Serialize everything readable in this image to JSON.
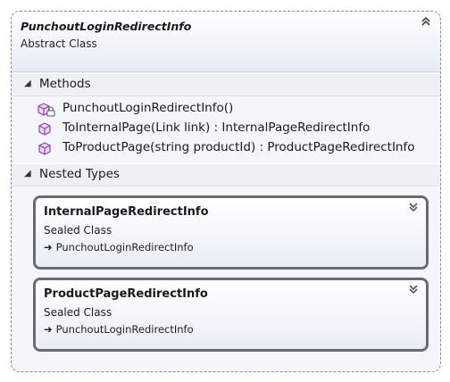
{
  "class": {
    "name": "PunchoutLoginRedirectInfo",
    "kind": "Abstract Class",
    "collapse_icon": "double-chevron-up-icon"
  },
  "sections": {
    "methods": {
      "label": "Methods",
      "arrow": "◢"
    },
    "nested": {
      "label": "Nested Types",
      "arrow": "◢"
    }
  },
  "methods": [
    {
      "icon": "protected-method-icon",
      "text": "PunchoutLoginRedirectInfo()"
    },
    {
      "icon": "public-method-icon",
      "text": "ToInternalPage(Link link) : InternalPageRedirectInfo"
    },
    {
      "icon": "public-method-icon",
      "text": "ToProductPage(string productId) : ProductPageRedirectInfo"
    }
  ],
  "nested_types": [
    {
      "name": "InternalPageRedirectInfo",
      "kind": "Sealed Class",
      "base": "PunchoutLoginRedirectInfo",
      "expand_icon": "double-chevron-down-icon"
    },
    {
      "name": "ProductPageRedirectInfo",
      "kind": "Sealed Class",
      "base": "PunchoutLoginRedirectInfo",
      "expand_icon": "double-chevron-down-icon"
    }
  ],
  "colors": {
    "method_icon": "#9b59b6",
    "border": "#676b73"
  }
}
